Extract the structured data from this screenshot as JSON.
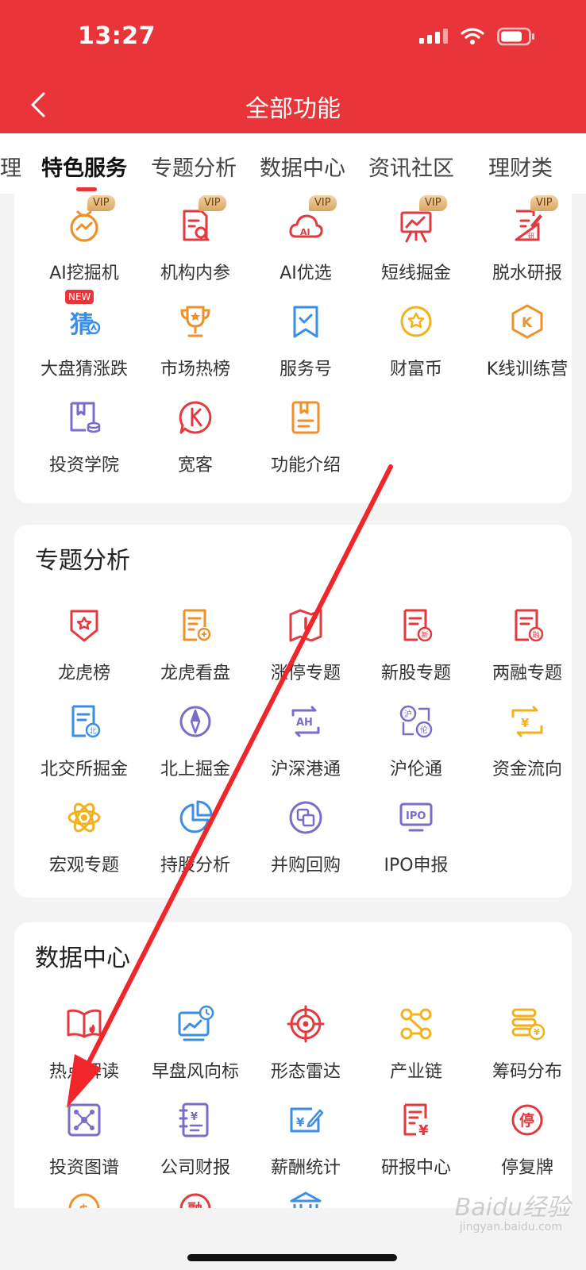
{
  "status": {
    "time": "13:27"
  },
  "nav": {
    "title": "全部功能",
    "back_icon": "chevron-left-icon"
  },
  "tabs": [
    {
      "label": "理"
    },
    {
      "label": "特色服务",
      "active": true
    },
    {
      "label": "专题分析"
    },
    {
      "label": "数据中心"
    },
    {
      "label": "资讯社区"
    },
    {
      "label": "理财类"
    }
  ],
  "badges": {
    "vip": "VIP",
    "new": "NEW"
  },
  "sections": {
    "featured": {
      "items": [
        {
          "label": "AI挖掘机",
          "icon": "ai-monitor-icon",
          "badge": "VIP"
        },
        {
          "label": "机构内参",
          "icon": "report-search-icon",
          "badge": "VIP"
        },
        {
          "label": "AI优选",
          "icon": "ai-cloud-icon",
          "badge": "VIP"
        },
        {
          "label": "短线掘金",
          "icon": "easel-chart-icon",
          "badge": "VIP"
        },
        {
          "label": "脱水研报",
          "icon": "edit-document-icon",
          "badge": "VIP"
        },
        {
          "label": "大盘猜涨跌",
          "icon": "guess-icon",
          "badge": "NEW"
        },
        {
          "label": "市场热榜",
          "icon": "trophy-icon"
        },
        {
          "label": "服务号",
          "icon": "bookmark-check-icon"
        },
        {
          "label": "财富币",
          "icon": "star-coin-icon"
        },
        {
          "label": "K线训练营",
          "icon": "hexagon-k-icon"
        },
        {
          "label": "投资学院",
          "icon": "book-coins-icon"
        },
        {
          "label": "宽客",
          "icon": "k-chat-icon"
        },
        {
          "label": "功能介绍",
          "icon": "booklet-icon"
        }
      ]
    },
    "topics": {
      "title": "专题分析",
      "items": [
        {
          "label": "龙虎榜",
          "icon": "shield-star-icon"
        },
        {
          "label": "龙虎看盘",
          "icon": "document-coin-icon"
        },
        {
          "label": "涨停专题",
          "icon": "map-alert-icon"
        },
        {
          "label": "新股专题",
          "icon": "document-new-icon"
        },
        {
          "label": "两融专题",
          "icon": "document-margin-icon"
        },
        {
          "label": "北交所掘金",
          "icon": "document-bei-icon"
        },
        {
          "label": "北上掘金",
          "icon": "compass-icon"
        },
        {
          "label": "沪深港通",
          "icon": "ah-exchange-icon"
        },
        {
          "label": "沪伦通",
          "icon": "hu-lun-exchange-icon"
        },
        {
          "label": "资金流向",
          "icon": "yuan-exchange-icon"
        },
        {
          "label": "宏观专题",
          "icon": "atom-icon"
        },
        {
          "label": "持股分析",
          "icon": "pie-chart-icon"
        },
        {
          "label": "并购回购",
          "icon": "merge-squares-icon"
        },
        {
          "label": "IPO申报",
          "icon": "ipo-monitor-icon"
        }
      ]
    },
    "data_center": {
      "title": "数据中心",
      "items": [
        {
          "label": "热点解读",
          "icon": "book-fire-icon"
        },
        {
          "label": "早盘风向标",
          "icon": "chart-clock-icon"
        },
        {
          "label": "形态雷达",
          "icon": "radar-icon"
        },
        {
          "label": "产业链",
          "icon": "chain-nodes-icon"
        },
        {
          "label": "筹码分布",
          "icon": "stacked-coins-icon"
        },
        {
          "label": "投资图谱",
          "icon": "network-graph-icon"
        },
        {
          "label": "公司财报",
          "icon": "financial-notebook-icon"
        },
        {
          "label": "薪酬统计",
          "icon": "salary-edit-icon"
        },
        {
          "label": "研报中心",
          "icon": "research-yuan-icon"
        },
        {
          "label": "停复牌",
          "icon": "suspend-circle-icon"
        }
      ]
    }
  },
  "watermark": {
    "main": "Baidu经验",
    "sub": "jingyan.baidu.com"
  },
  "colors": {
    "brand_red": "#e93539",
    "annotation_arrow": "#f0262b"
  }
}
